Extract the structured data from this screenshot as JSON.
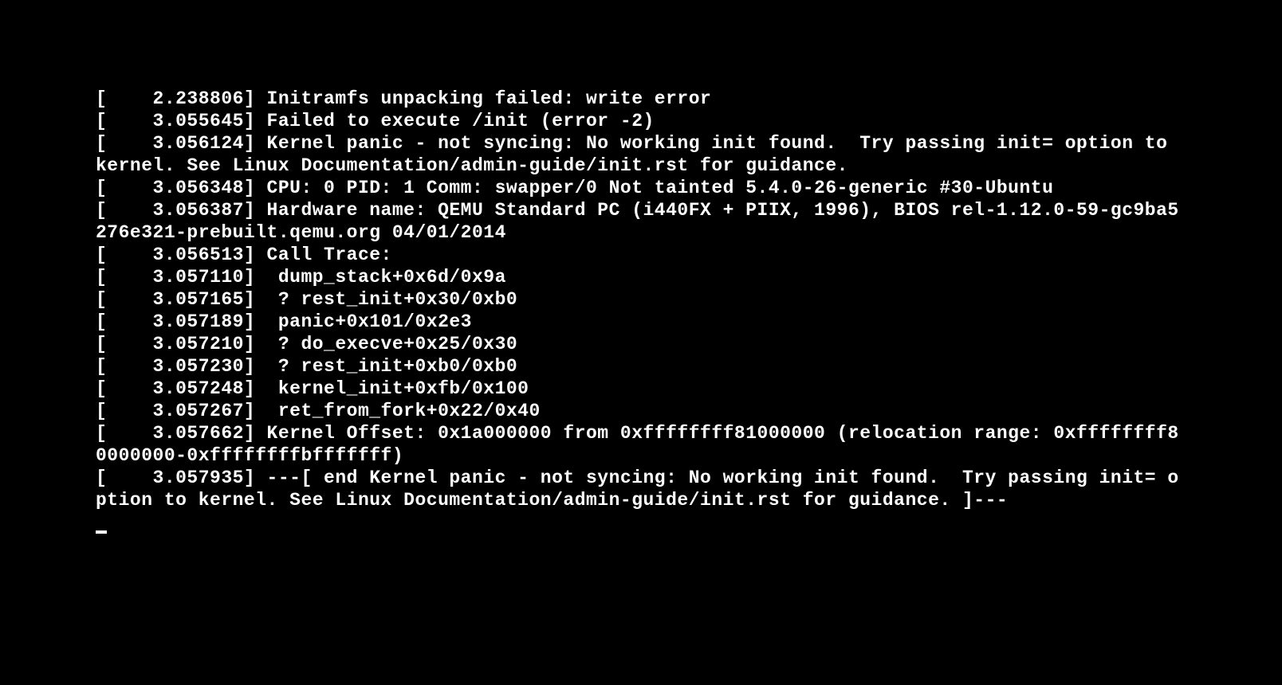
{
  "console": {
    "lines": [
      "[    2.238806] Initramfs unpacking failed: write error",
      "[    3.055645] Failed to execute /init (error -2)",
      "[    3.056124] Kernel panic - not syncing: No working init found.  Try passing init= option to kernel. See Linux Documentation/admin-guide/init.rst for guidance.",
      "[    3.056348] CPU: 0 PID: 1 Comm: swapper/0 Not tainted 5.4.0-26-generic #30-Ubuntu",
      "[    3.056387] Hardware name: QEMU Standard PC (i440FX + PIIX, 1996), BIOS rel-1.12.0-59-gc9ba5276e321-prebuilt.qemu.org 04/01/2014",
      "[    3.056513] Call Trace:",
      "[    3.057110]  dump_stack+0x6d/0x9a",
      "[    3.057165]  ? rest_init+0x30/0xb0",
      "[    3.057189]  panic+0x101/0x2e3",
      "[    3.057210]  ? do_execve+0x25/0x30",
      "[    3.057230]  ? rest_init+0xb0/0xb0",
      "[    3.057248]  kernel_init+0xfb/0x100",
      "[    3.057267]  ret_from_fork+0x22/0x40",
      "[    3.057662] Kernel Offset: 0x1a000000 from 0xffffffff81000000 (relocation range: 0xffffffff80000000-0xffffffffbfffffff)",
      "[    3.057935] ---[ end Kernel panic - not syncing: No working init found.  Try passing init= option to kernel. See Linux Documentation/admin-guide/init.rst for guidance. ]---"
    ]
  }
}
